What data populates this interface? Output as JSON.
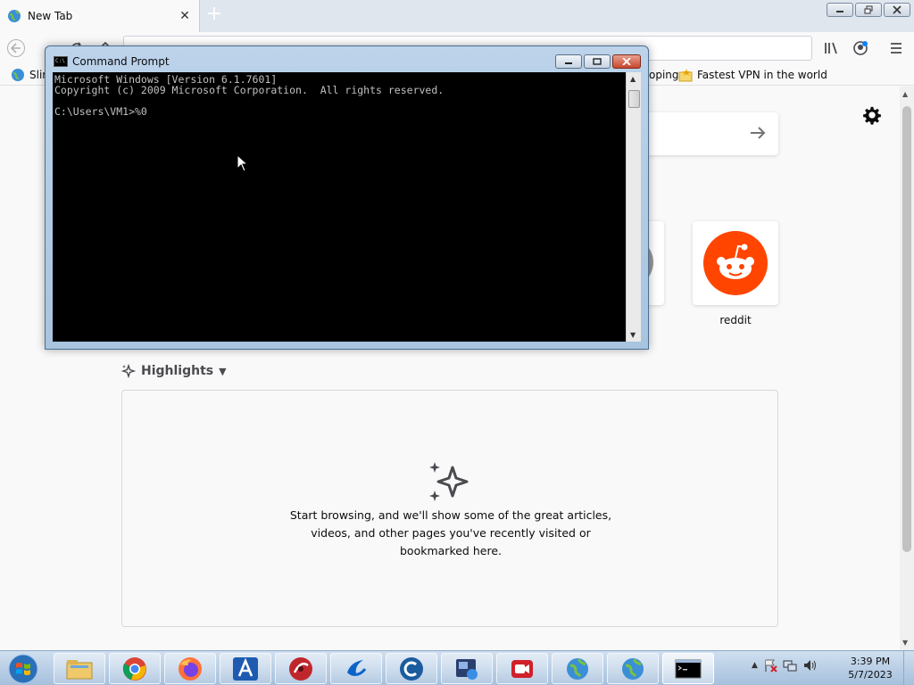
{
  "browser": {
    "tab_title": "New Tab",
    "bookmarks": [
      {
        "label": "Slim"
      },
      {
        "label": "oping"
      },
      {
        "label": "Fastest VPN in the world"
      }
    ]
  },
  "newtab": {
    "top_sites": [
      {
        "label": "reddit"
      }
    ],
    "highlights_label": "Highlights",
    "highlights_empty_text": "Start browsing, and we'll show some of the great articles, videos, and other pages you've recently visited or bookmarked here."
  },
  "cmd": {
    "title": "Command Prompt",
    "lines": [
      "Microsoft Windows [Version 6.1.7601]",
      "Copyright (c) 2009 Microsoft Corporation.  All rights reserved.",
      "",
      "C:\\Users\\VM1>%0"
    ]
  },
  "taskbar": {
    "time": "3:39 PM",
    "date": "5/7/2023"
  },
  "colors": {
    "reddit": "#ff4500",
    "console_bg": "#000000",
    "console_text": "#c0c0c0"
  }
}
